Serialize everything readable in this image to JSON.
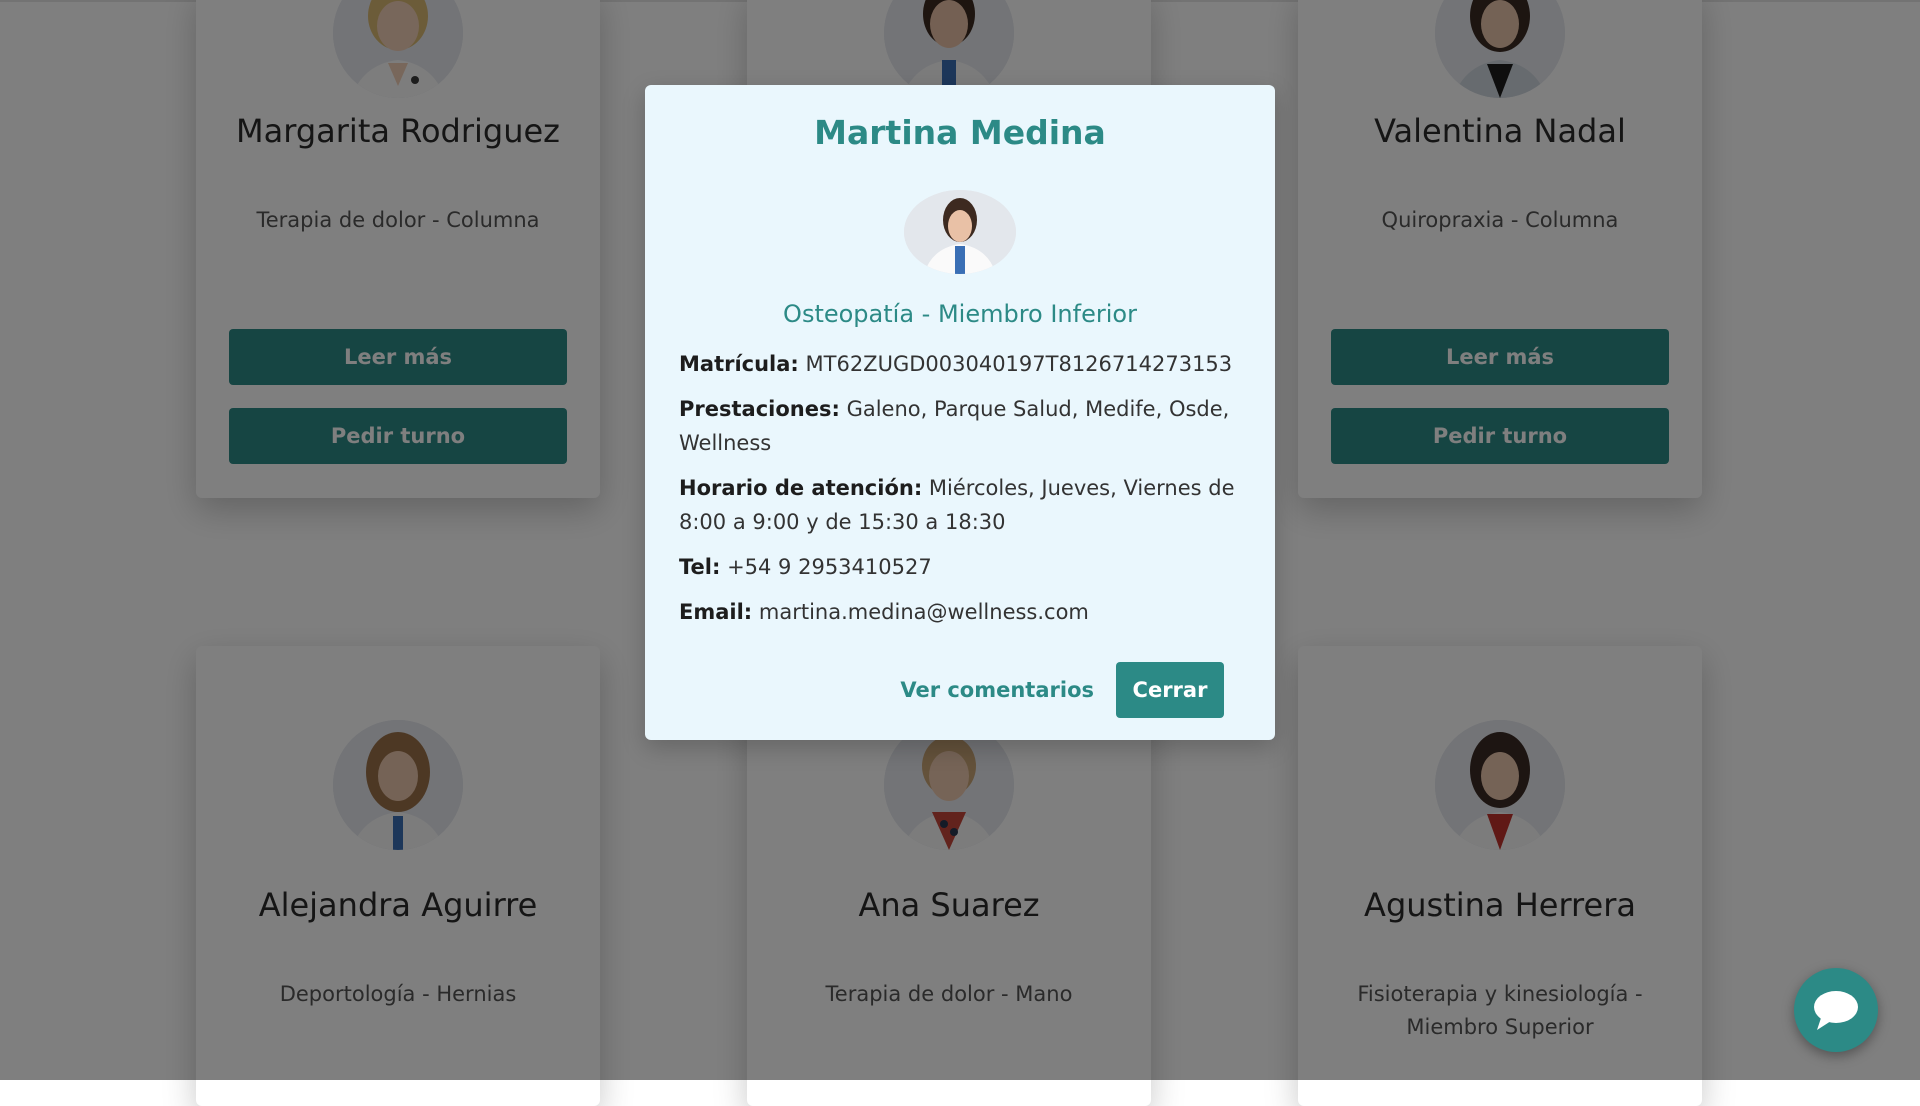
{
  "cards": [
    {
      "name": "Margarita Rodriguez",
      "specialty": "Terapia de dolor - Columna",
      "read_more": "Leer más",
      "book": "Pedir turno"
    },
    {
      "name": "",
      "specialty": "",
      "read_more": "",
      "book": ""
    },
    {
      "name": "Valentina Nadal",
      "specialty": "Quiropraxia - Columna",
      "read_more": "Leer más",
      "book": "Pedir turno"
    },
    {
      "name": "Alejandra Aguirre",
      "specialty": "Deportología - Hernias"
    },
    {
      "name": "Ana Suarez",
      "specialty": "Terapia de dolor - Mano"
    },
    {
      "name": "Agustina Herrera",
      "specialty": "Fisioterapia y kinesiología - Miembro Superior"
    }
  ],
  "modal": {
    "title": "Martina Medina",
    "specialty": "Osteopatía - Miembro Inferior",
    "matricula_label": "Matrícula:",
    "matricula": "MT62ZUGD003040197T8126714273153",
    "prestaciones_label": "Prestaciones:",
    "prestaciones": "Galeno, Parque Salud, Medife, Osde, Wellness",
    "horario_label": "Horario de atención:",
    "horario": "Miércoles, Jueves, Viernes de 8:00 a 9:00 y de 15:30 a 18:30",
    "tel_label": "Tel:",
    "tel": "+54 9 2953410527",
    "email_label": "Email:",
    "email": "martina.medina@wellness.com",
    "comments_link": "Ver comentarios",
    "close_button": "Cerrar"
  },
  "colors": {
    "accent": "#2c8a86",
    "modal_bg": "#eaf7fd",
    "overlay": "rgba(0,0,0,0.5)"
  },
  "icons": {
    "chat": "chat-bubble-icon"
  }
}
